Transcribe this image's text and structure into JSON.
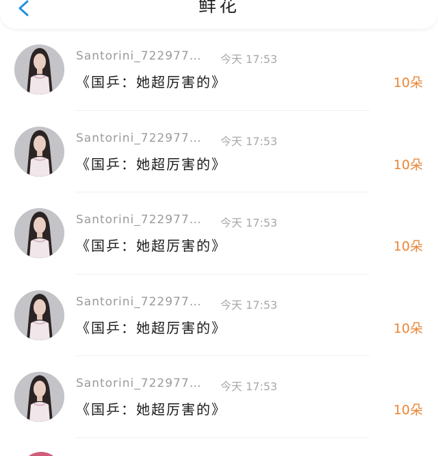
{
  "header": {
    "title": "鲜花",
    "back_icon": "chevron-left-icon",
    "accent_color": "#1e90e6"
  },
  "list": {
    "items": [
      {
        "username": "Santorini_722977…",
        "time": "今天 17:53",
        "message": "《国乒：她超厉害的》",
        "amount": "10朵"
      },
      {
        "username": "Santorini_722977…",
        "time": "今天 17:53",
        "message": "《国乒：她超厉害的》",
        "amount": "10朵"
      },
      {
        "username": "Santorini_722977…",
        "time": "今天 17:53",
        "message": "《国乒：她超厉害的》",
        "amount": "10朵"
      },
      {
        "username": "Santorini_722977…",
        "time": "今天 17:53",
        "message": "《国乒：她超厉害的》",
        "amount": "10朵"
      },
      {
        "username": "Santorini_722977…",
        "time": "今天 17:53",
        "message": "《国乒：她超厉害的》",
        "amount": "10朵"
      }
    ],
    "amount_color": "#e98536"
  }
}
